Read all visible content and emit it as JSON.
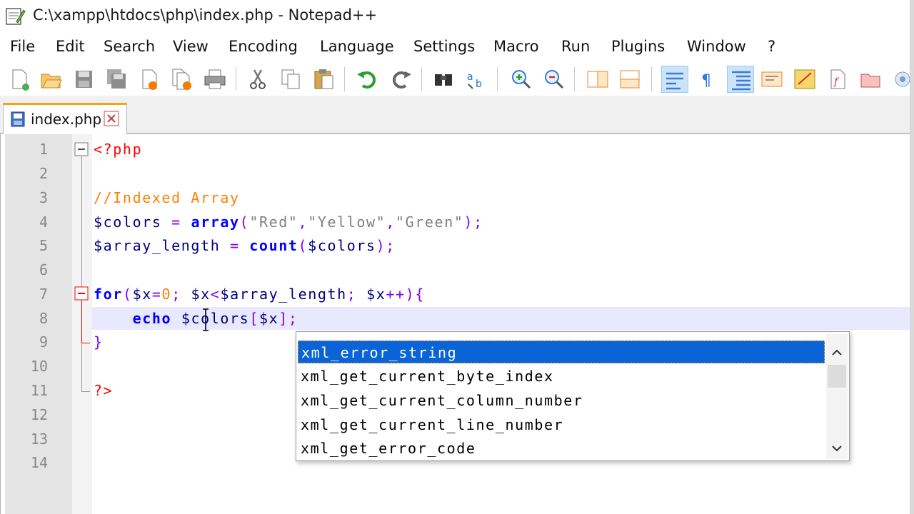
{
  "window": {
    "title": "C:\\xampp\\htdocs\\php\\index.php - Notepad++",
    "icon": "notepad-plus-plus-icon"
  },
  "menu": [
    "File",
    "Edit",
    "Search",
    "View",
    "Encoding",
    "Language",
    "Settings",
    "Macro",
    "Run",
    "Plugins",
    "Window",
    "?"
  ],
  "toolbar": {
    "buttons": [
      "new-file",
      "open-file",
      "save",
      "save-all",
      "close",
      "close-all",
      "print",
      "cut",
      "copy",
      "paste",
      "undo",
      "redo",
      "find",
      "replace",
      "zoom-in",
      "zoom-out",
      "sync-vertical",
      "sync-horizontal",
      "word-wrap",
      "show-all-characters",
      "indent-guide",
      "document-map",
      "function-list",
      "folder-as-workspace",
      "monitoring"
    ]
  },
  "tab": {
    "label": "index.php"
  },
  "editor": {
    "line_numbers": [
      "1",
      "2",
      "3",
      "4",
      "5",
      "6",
      "7",
      "8",
      "9",
      "10",
      "11",
      "12",
      "13",
      "14"
    ],
    "lines": {
      "l1": "<?php",
      "l3": "//Indexed Array",
      "l4_var": "$colors",
      "l4_eq": " = ",
      "l4_fn": "array",
      "l4_p1": "(",
      "l4_s1": "\"Red\"",
      "l4_c1": ",",
      "l4_s2": "\"Yellow\"",
      "l4_c2": ",",
      "l4_s3": "\"Green\"",
      "l4_p2": ");",
      "l5_var": "$array_length",
      "l5_eq": " = ",
      "l5_fn": "count",
      "l5_p1": "(",
      "l5_arg": "$colors",
      "l5_p2": ");",
      "l7_kw": "for",
      "l7_p1": "(",
      "l7_v1": "$x",
      "l7_eq": "=",
      "l7_n": "0",
      "l7_sc": "; ",
      "l7_v2": "$x",
      "l7_lt": "<",
      "l7_v3": "$array_length",
      "l7_sc2": "; ",
      "l7_v4": "$x",
      "l7_pp": "++",
      "l7_p2": "){",
      "l8_indent": "    ",
      "l8_kw": "echo",
      "l8_sp": " ",
      "l8_var": "$colors",
      "l8_b1": "[",
      "l8_idx": "$x",
      "l8_b2": "];",
      "l9": "}",
      "l11": "?>"
    }
  },
  "autocomplete": {
    "items": [
      "xml_error_string",
      "xml_get_current_byte_index",
      "xml_get_current_column_number",
      "xml_get_current_line_number",
      "xml_get_error_code"
    ],
    "selected_index": 0
  },
  "colors": {
    "keyword": "#0000ff",
    "variable": "#000080",
    "string": "#808080",
    "comment": "#ff8000",
    "operator": "#8000ff",
    "php_tag": "#ff0000",
    "selection": "#0a64d8",
    "caret_line": "#e8e8ff"
  }
}
